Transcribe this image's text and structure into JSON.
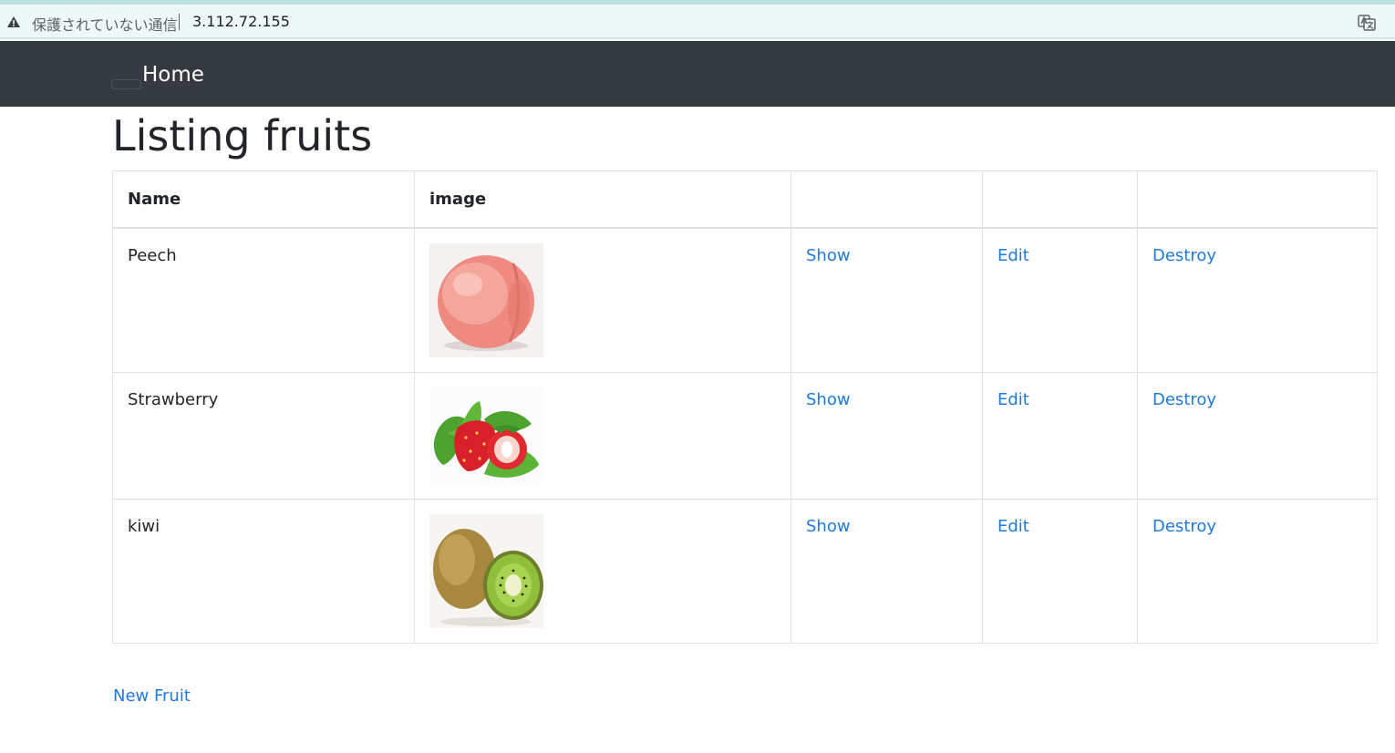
{
  "browser": {
    "security_label": "保護されていない通信",
    "url": "3.112.72.155",
    "icons": [
      "warning-icon",
      "translate-icon"
    ]
  },
  "navbar": {
    "brand": "Home"
  },
  "page": {
    "title": "Listing fruits"
  },
  "table": {
    "columns": [
      "Name",
      "image",
      "",
      "",
      ""
    ],
    "rows": [
      {
        "name": "Peech",
        "image": "peach",
        "show": "Show",
        "edit": "Edit",
        "destroy": "Destroy"
      },
      {
        "name": "Strawberry",
        "image": "strawberry",
        "show": "Show",
        "edit": "Edit",
        "destroy": "Destroy"
      },
      {
        "name": "kiwi",
        "image": "kiwi",
        "show": "Show",
        "edit": "Edit",
        "destroy": "Destroy"
      }
    ]
  },
  "footer": {
    "new_link": "New Fruit"
  },
  "colors": {
    "navbar": "#343a40",
    "link": "#1f7ae0",
    "border": "#dee2e6"
  }
}
